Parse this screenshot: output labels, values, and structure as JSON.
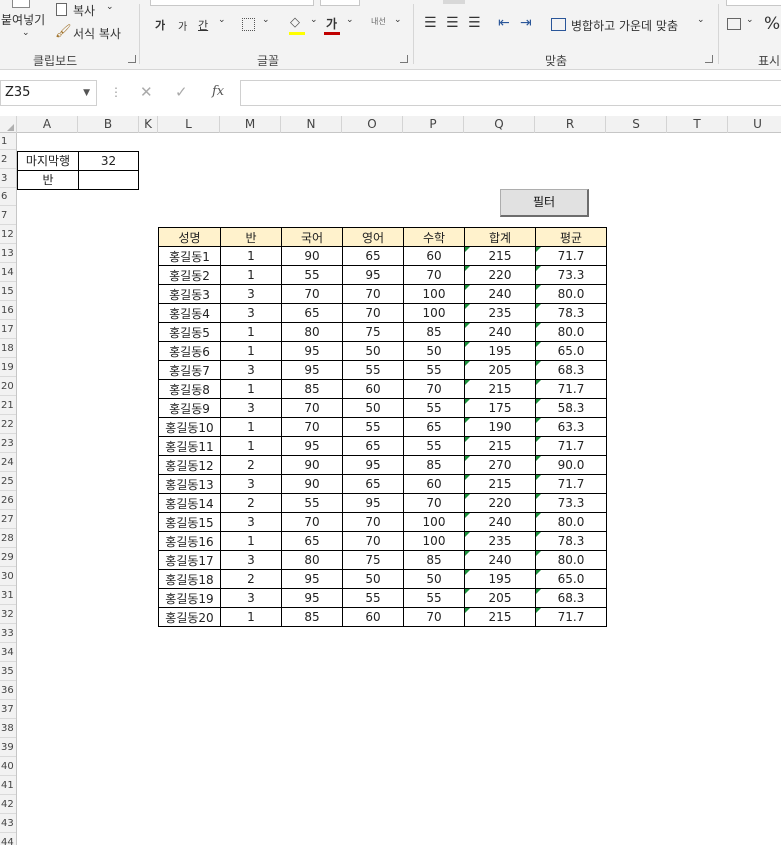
{
  "ribbon": {
    "clipboard": {
      "paste_label": "붙여넣기",
      "copy_label": "복사",
      "format_painter_label": "서식 복사",
      "group_label": "클립보드"
    },
    "font": {
      "increase_size": "가",
      "decrease_size": "가",
      "underline_char": "간",
      "font_color_char": "가",
      "phonetic_label": "내선",
      "group_label": "글꼴"
    },
    "alignment": {
      "merge_center_label": "병합하고 가운데 맞춤",
      "group_label": "맞춤"
    },
    "number": {
      "percent_label": "%",
      "group_label": "표시"
    }
  },
  "formula_bar": {
    "name_box": "Z35",
    "fx_label": "fx",
    "formula": ""
  },
  "grid": {
    "column_headers": [
      "A",
      "B",
      "K",
      "L",
      "M",
      "N",
      "O",
      "P",
      "Q",
      "R",
      "S",
      "T",
      "U"
    ],
    "row_headers": [
      "1",
      "2",
      "3",
      "6",
      "7",
      "12",
      "13",
      "14",
      "15",
      "16",
      "17",
      "18",
      "19",
      "20",
      "21",
      "22",
      "23",
      "24",
      "25",
      "26",
      "27",
      "28",
      "29",
      "30",
      "31",
      "32",
      "33",
      "34",
      "35",
      "36",
      "37",
      "38",
      "39",
      "40",
      "41",
      "42",
      "43",
      "44"
    ]
  },
  "info_cells": {
    "last_row_label": "마지막행",
    "last_row_value": "32",
    "class_label": "반",
    "class_value": ""
  },
  "filter_button_label": "필터",
  "table": {
    "headers": [
      "성명",
      "반",
      "국어",
      "영어",
      "수학",
      "합계",
      "평균"
    ],
    "rows": [
      [
        "홍길동1",
        "1",
        "90",
        "65",
        "60",
        "215",
        "71.7"
      ],
      [
        "홍길동2",
        "1",
        "55",
        "95",
        "70",
        "220",
        "73.3"
      ],
      [
        "홍길동3",
        "3",
        "70",
        "70",
        "100",
        "240",
        "80.0"
      ],
      [
        "홍길동4",
        "3",
        "65",
        "70",
        "100",
        "235",
        "78.3"
      ],
      [
        "홍길동5",
        "1",
        "80",
        "75",
        "85",
        "240",
        "80.0"
      ],
      [
        "홍길동6",
        "1",
        "95",
        "50",
        "50",
        "195",
        "65.0"
      ],
      [
        "홍길동7",
        "3",
        "95",
        "55",
        "55",
        "205",
        "68.3"
      ],
      [
        "홍길동8",
        "1",
        "85",
        "60",
        "70",
        "215",
        "71.7"
      ],
      [
        "홍길동9",
        "3",
        "70",
        "50",
        "55",
        "175",
        "58.3"
      ],
      [
        "홍길동10",
        "1",
        "70",
        "55",
        "65",
        "190",
        "63.3"
      ],
      [
        "홍길동11",
        "1",
        "95",
        "65",
        "55",
        "215",
        "71.7"
      ],
      [
        "홍길동12",
        "2",
        "90",
        "95",
        "85",
        "270",
        "90.0"
      ],
      [
        "홍길동13",
        "3",
        "90",
        "65",
        "60",
        "215",
        "71.7"
      ],
      [
        "홍길동14",
        "2",
        "55",
        "95",
        "70",
        "220",
        "73.3"
      ],
      [
        "홍길동15",
        "3",
        "70",
        "70",
        "100",
        "240",
        "80.0"
      ],
      [
        "홍길동16",
        "1",
        "65",
        "70",
        "100",
        "235",
        "78.3"
      ],
      [
        "홍길동17",
        "3",
        "80",
        "75",
        "85",
        "240",
        "80.0"
      ],
      [
        "홍길동18",
        "2",
        "95",
        "50",
        "50",
        "195",
        "65.0"
      ],
      [
        "홍길동19",
        "3",
        "95",
        "55",
        "55",
        "205",
        "68.3"
      ],
      [
        "홍길동20",
        "1",
        "85",
        "60",
        "70",
        "215",
        "71.7"
      ]
    ]
  },
  "colors": {
    "header_fill": "#fff2cc",
    "error_indicator": "#1a8f3a",
    "font_color_bar": "#c00000",
    "highlight_bar": "#ffff00"
  }
}
